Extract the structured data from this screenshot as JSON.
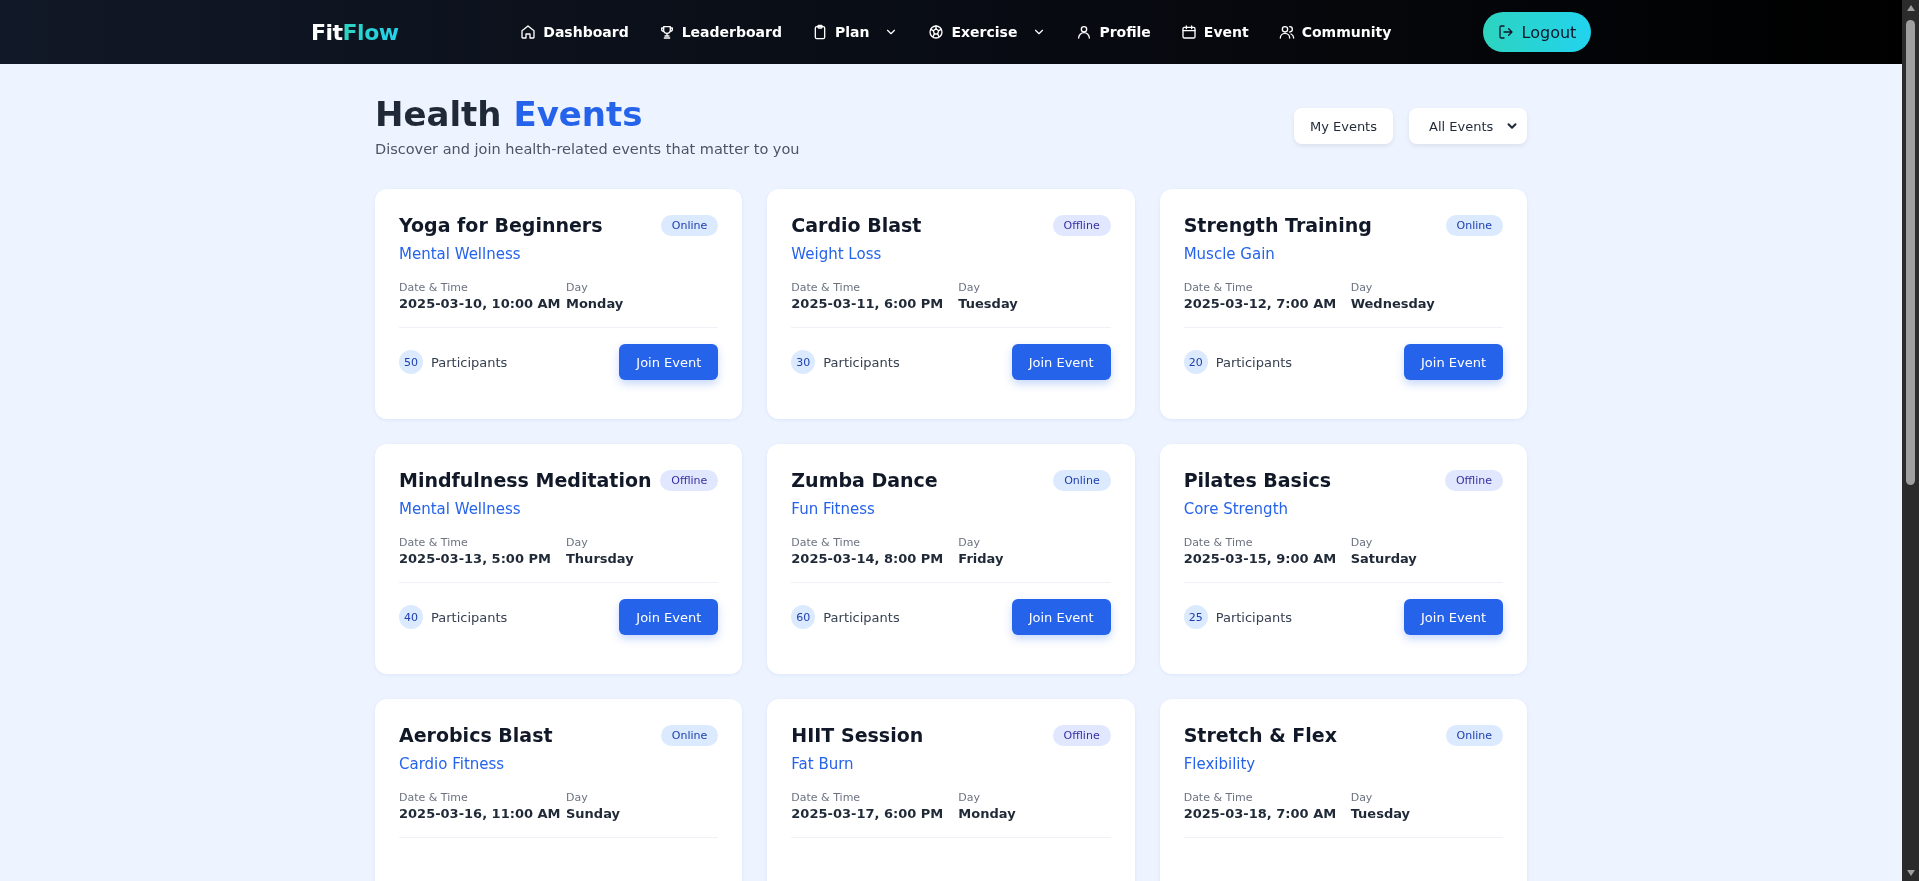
{
  "navbar": {
    "logo": {
      "first": "Fit",
      "second": "Flow"
    },
    "items": [
      {
        "label": "Dashboard",
        "has_menu": false
      },
      {
        "label": "Leaderboard",
        "has_menu": false
      },
      {
        "label": "Plan",
        "has_menu": true
      },
      {
        "label": "Exercise",
        "has_menu": true
      },
      {
        "label": "Profile",
        "has_menu": false
      },
      {
        "label": "Event",
        "has_menu": false
      },
      {
        "label": "Community",
        "has_menu": false
      }
    ],
    "logout": "Logout"
  },
  "header": {
    "title_first": "Health",
    "title_second": "Events",
    "subtitle": "Discover and join health-related events that matter to you",
    "my_events": "My Events",
    "filter": "All Events"
  },
  "events": [
    {
      "title": "Yoga for Beginners",
      "badge": {
        "label": "Online",
        "kind": "online"
      },
      "category": "Mental Wellness",
      "date_label": "Date & Time",
      "date": "2025-03-10, 10:00 AM",
      "day_label": "Day",
      "day": "Monday",
      "participants": "50",
      "participants_label": "Participants",
      "button": "Join Event"
    },
    {
      "title": "Cardio Blast",
      "badge": {
        "label": "Offline",
        "kind": "offline"
      },
      "category": "Weight Loss",
      "date_label": "Date & Time",
      "date": "2025-03-11, 6:00 PM",
      "day_label": "Day",
      "day": "Tuesday",
      "participants": "30",
      "participants_label": "Participants",
      "button": "Join Event"
    },
    {
      "title": "Strength Training",
      "badge": {
        "label": "Online",
        "kind": "online"
      },
      "category": "Muscle Gain",
      "date_label": "Date & Time",
      "date": "2025-03-12, 7:00 AM",
      "day_label": "Day",
      "day": "Wednesday",
      "participants": "20",
      "participants_label": "Participants",
      "button": "Join Event"
    },
    {
      "title": "Mindfulness Meditation",
      "badge": {
        "label": "Offline",
        "kind": "offline"
      },
      "category": "Mental Wellness",
      "date_label": "Date & Time",
      "date": "2025-03-13, 5:00 PM",
      "day_label": "Day",
      "day": "Thursday",
      "participants": "40",
      "participants_label": "Participants",
      "button": "Join Event"
    },
    {
      "title": "Zumba Dance",
      "badge": {
        "label": "Online",
        "kind": "online"
      },
      "category": "Fun Fitness",
      "date_label": "Date & Time",
      "date": "2025-03-14, 8:00 PM",
      "day_label": "Day",
      "day": "Friday",
      "participants": "60",
      "participants_label": "Participants",
      "button": "Join Event"
    },
    {
      "title": "Pilates Basics",
      "badge": {
        "label": "Offline",
        "kind": "offline"
      },
      "category": "Core Strength",
      "date_label": "Date & Time",
      "date": "2025-03-15, 9:00 AM",
      "day_label": "Day",
      "day": "Saturday",
      "participants": "25",
      "participants_label": "Participants",
      "button": "Join Event"
    },
    {
      "title": "Aerobics Blast",
      "badge": {
        "label": "Online",
        "kind": "online"
      },
      "category": "Cardio Fitness",
      "date_label": "Date & Time",
      "date": "2025-03-16, 11:00 AM",
      "day_label": "Day",
      "day": "Sunday"
    },
    {
      "title": "HIIT Session",
      "badge": {
        "label": "Offline",
        "kind": "offline"
      },
      "category": "Fat Burn",
      "date_label": "Date & Time",
      "date": "2025-03-17, 6:00 PM",
      "day_label": "Day",
      "day": "Monday"
    },
    {
      "title": "Stretch & Flex",
      "badge": {
        "label": "Online",
        "kind": "online"
      },
      "category": "Flexibility",
      "date_label": "Date & Time",
      "date": "2025-03-18, 7:00 AM",
      "day_label": "Day",
      "day": "Tuesday"
    }
  ]
}
